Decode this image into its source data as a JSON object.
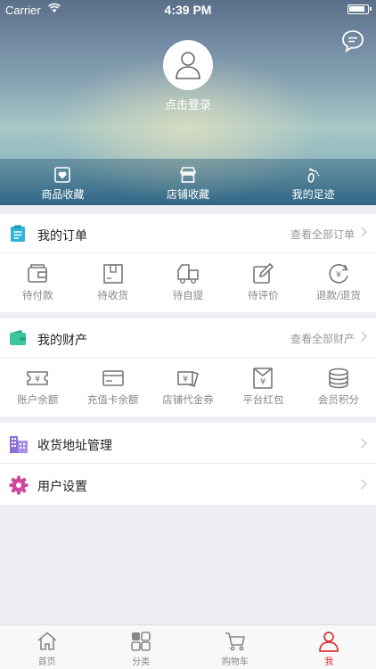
{
  "status": {
    "carrier": "Carrier",
    "time": "4:39 PM"
  },
  "header": {
    "login_text": "点击登录"
  },
  "quick": [
    {
      "label": "商品收藏",
      "icon": "heart-box-icon"
    },
    {
      "label": "店铺收藏",
      "icon": "store-icon"
    },
    {
      "label": "我的足迹",
      "icon": "footprint-icon"
    }
  ],
  "orders": {
    "title": "我的订单",
    "more": "查看全部订单",
    "items": [
      "待付款",
      "待收货",
      "待自提",
      "待评价",
      "退款/退货"
    ]
  },
  "assets": {
    "title": "我的财产",
    "more": "查看全部财产",
    "items": [
      "账户余额",
      "充值卡余额",
      "店铺代金券",
      "平台红包",
      "会员积分"
    ]
  },
  "rows": [
    "收货地址管理",
    "用户设置"
  ],
  "tabs": [
    "首页",
    "分类",
    "购物车",
    "我"
  ],
  "colors": {
    "accent": "#e0303a",
    "orders_icon": "#2cb5d9",
    "assets_icon": "#3cc7a0",
    "address_icon": "#8a6fd6",
    "settings_icon": "#d0479e"
  }
}
